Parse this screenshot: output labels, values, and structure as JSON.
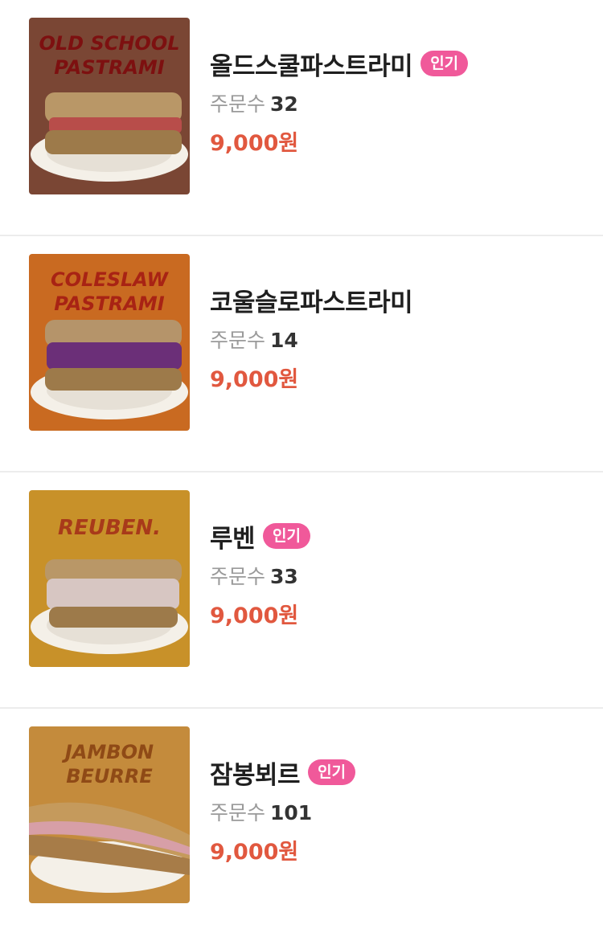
{
  "menu": {
    "orders_label": "주문수",
    "items": [
      {
        "name": "올드스쿨파스트라미",
        "badge": "인기",
        "orders": "32",
        "price": "9,000원",
        "image_text": [
          "OLD SCHOOL",
          "PASTRAMI"
        ],
        "bg_color": "#7a4634",
        "filling_color": "#b84d4a"
      },
      {
        "name": "코울슬로파스트라미",
        "badge": "",
        "orders": "14",
        "price": "9,000원",
        "image_text": [
          "COLESLAW",
          "PASTRAMI"
        ],
        "bg_color": "#c96a21",
        "filling_color": "#6b2f78"
      },
      {
        "name": "루벤",
        "badge": "인기",
        "orders": "33",
        "price": "9,000원",
        "image_text": [
          "REUBEN.",
          ""
        ],
        "bg_color": "#c89129",
        "filling_color": "#d7c6c2"
      },
      {
        "name": "잠봉뵈르",
        "badge": "인기",
        "orders": "101",
        "price": "9,000원",
        "image_text": [
          "JAMBON",
          "BEURRE"
        ],
        "bg_color": "#c48b3c",
        "filling_color": "#d79fa7"
      }
    ]
  }
}
